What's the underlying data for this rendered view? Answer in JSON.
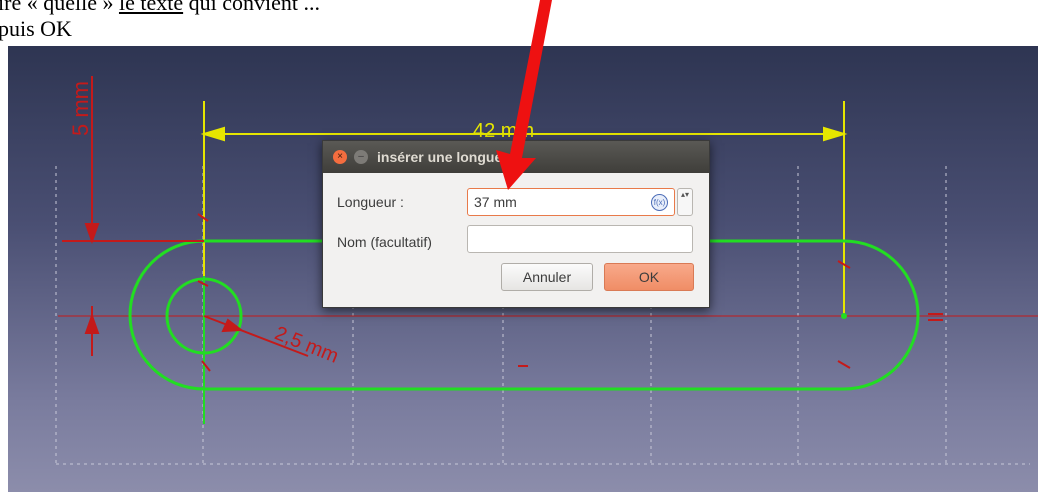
{
  "document": {
    "line1_start": "ire « quelle » ",
    "line1_underlined": "le texte",
    "line1_end": " qui convient ...",
    "line2": "puis OK"
  },
  "sketch": {
    "dim_top": "42 mm",
    "dim_left": "5 mm",
    "dim_radius": "2,5 mm"
  },
  "dialog": {
    "close_glyph": "×",
    "min_glyph": "–",
    "title": "insérer une longueur",
    "length_label": "Longueur :",
    "length_value": "37 mm",
    "fx_glyph": "f(x)",
    "spin_glyph": "▴▾",
    "name_label": "Nom (facultatif)",
    "name_value": "",
    "cancel_label": "Annuler",
    "ok_label": "OK"
  },
  "colors": {
    "sketch_green": "#22dd22",
    "construction_yellow": "#e6e600",
    "dimension_red": "#c41a1a",
    "callout_arrow": "#ee1111"
  }
}
